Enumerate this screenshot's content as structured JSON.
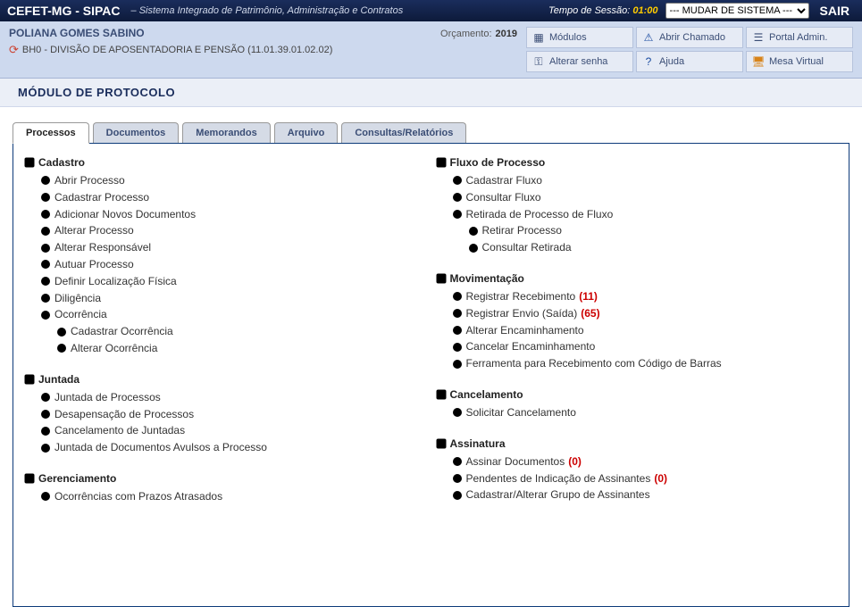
{
  "topbar": {
    "brand": "CEFET-MG - SIPAC",
    "subtitle": "– Sistema Integrado de Patrimônio, Administração e Contratos",
    "session_label": "Tempo de Sessão:",
    "session_time": "01:00",
    "system_select": "--- MUDAR DE SISTEMA --- ",
    "sair": "SAIR"
  },
  "user": {
    "name": "POLIANA GOMES SABINO",
    "dept": "BH0 - DIVISÃO DE APOSENTADORIA E PENSÃO (11.01.39.01.02.02)"
  },
  "budget": {
    "label": "Orçamento:",
    "year": "2019"
  },
  "links": {
    "modulos": "Módulos",
    "abrir_chamado": "Abrir Chamado",
    "portal_admin": "Portal Admin.",
    "alterar_senha": "Alterar senha",
    "ajuda": "Ajuda",
    "mesa_virtual": "Mesa Virtual"
  },
  "module_title": "Módulo de Protocolo",
  "tabs": {
    "processos": "Processos",
    "documentos": "Documentos",
    "memorandos": "Memorandos",
    "arquivo": "Arquivo",
    "consultas": "Consultas/Relatórios"
  },
  "groups": {
    "cadastro": {
      "title": "Cadastro",
      "abrir_processo": "Abrir Processo",
      "cadastrar_processo": "Cadastrar Processo",
      "adicionar_novos_documentos": "Adicionar Novos Documentos",
      "alterar_processo": "Alterar Processo",
      "alterar_responsavel": "Alterar Responsável",
      "autuar_processo": "Autuar Processo",
      "definir_localizacao_fisica": "Definir Localização Física",
      "diligencia": "Diligência",
      "ocorrencia": "Ocorrência",
      "cadastrar_ocorrencia": "Cadastrar Ocorrência",
      "alterar_ocorrencia": "Alterar Ocorrência"
    },
    "juntada": {
      "title": "Juntada",
      "juntada_processos": "Juntada de Processos",
      "desapensacao": "Desapensação de Processos",
      "cancelamento_juntadas": "Cancelamento de Juntadas",
      "juntada_documentos_avulsos": "Juntada de Documentos Avulsos a Processo"
    },
    "gerenciamento": {
      "title": "Gerenciamento",
      "ocorrencias_prazos": "Ocorrências com Prazos Atrasados"
    },
    "fluxo": {
      "title": "Fluxo de Processo",
      "cadastrar_fluxo": "Cadastrar Fluxo",
      "consultar_fluxo": "Consultar Fluxo",
      "retirada_fluxo": "Retirada de Processo de Fluxo",
      "retirar_processo": "Retirar Processo",
      "consultar_retirada": "Consultar Retirada"
    },
    "movimentacao": {
      "title": "Movimentação",
      "registrar_recebimento": "Registrar Recebimento",
      "registrar_recebimento_count": "(11)",
      "registrar_envio": "Registrar Envio (Saída)",
      "registrar_envio_count": "(65)",
      "alterar_encaminhamento": "Alterar Encaminhamento",
      "cancelar_encaminhamento": "Cancelar Encaminhamento",
      "ferramenta_recebimento": "Ferramenta para Recebimento com Código de Barras"
    },
    "cancelamento": {
      "title": "Cancelamento",
      "solicitar_cancelamento": "Solicitar Cancelamento"
    },
    "assinatura": {
      "title": "Assinatura",
      "assinar_documentos": "Assinar Documentos",
      "assinar_documentos_count": "(0)",
      "pendentes_indicacao": "Pendentes de Indicação de Assinantes",
      "pendentes_indicacao_count": "(0)",
      "cadastrar_grupo": "Cadastrar/Alterar Grupo de Assinantes"
    }
  }
}
